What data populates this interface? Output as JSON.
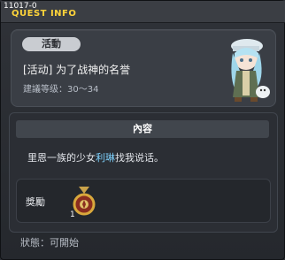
{
  "header": {
    "quest_id": "11017-0",
    "title": "QUEST INFO"
  },
  "quest": {
    "category": "活動",
    "name": "[活动] 为了战神的名誉",
    "level_label": "建議等级：",
    "level_range": "30～34"
  },
  "content": {
    "header": "內容",
    "text_before": "里恩一族的少女",
    "npc_name": "利琳",
    "text_after": "找我说话。"
  },
  "reward": {
    "label": "獎勵",
    "item_count": "1"
  },
  "status": {
    "label": "狀態：",
    "value": "可開始"
  },
  "colors": {
    "title_yellow": "#ffd43a",
    "npc_highlight": "#7fd3ff"
  }
}
